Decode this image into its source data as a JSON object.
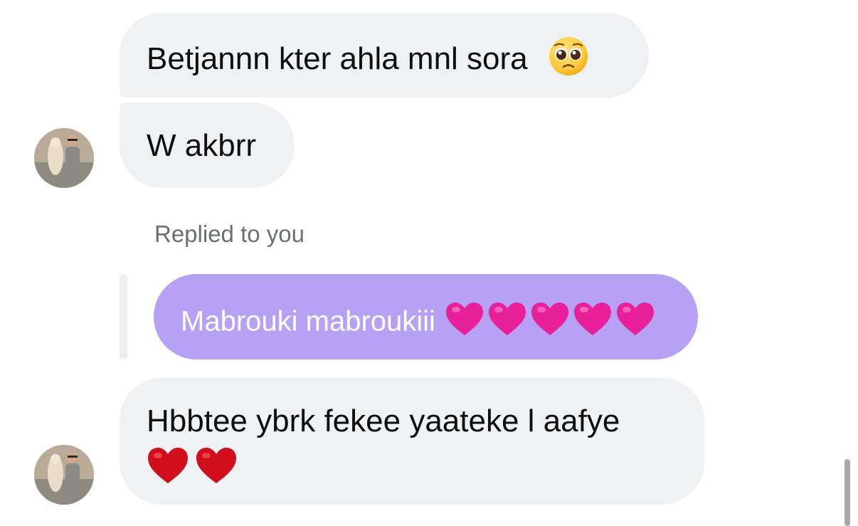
{
  "messages": [
    {
      "text": "Betjannn kter ahla mnl sora",
      "emoji": "pleading-face"
    },
    {
      "text": "W akbrr"
    },
    {
      "text": "Hbbtee ybrk fekee yaateke l aafye",
      "emoji": "red-heart x2"
    }
  ],
  "reply": {
    "label": "Replied to you",
    "quoted_text": "Mabrouki mabroukiii",
    "quoted_emoji": "pink-heart x5"
  },
  "colors": {
    "incoming_bubble": "#eff1f3",
    "reply_bubble": "#b6a1f5",
    "muted_text": "#6b6f75",
    "pink_heart": "#e8209a",
    "red_heart": "#d10e1b"
  }
}
